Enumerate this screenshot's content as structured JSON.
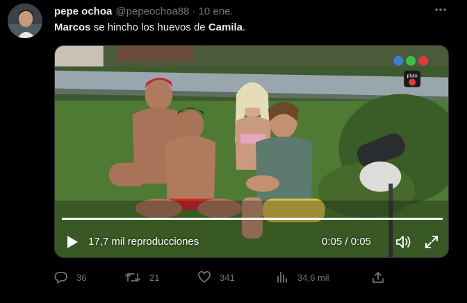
{
  "tweet": {
    "author_name": "pepe ochoa",
    "handle": "@pepeochoa88",
    "separator": "·",
    "date": "10 ene.",
    "text_parts": [
      "Marcos",
      " se hincho los huevos de ",
      "Camila",
      "."
    ]
  },
  "video": {
    "views": "17,7 mil reproducciones",
    "time": "0:05 / 0:05",
    "progress": 1.0,
    "channel_logo_text": "pluto tv"
  },
  "actions": {
    "replies": "36",
    "retweets": "21",
    "likes": "341",
    "views": "34,6 mil"
  },
  "colors": {
    "background": "#000000",
    "text": "#e7e9ea",
    "muted": "#71767b"
  }
}
